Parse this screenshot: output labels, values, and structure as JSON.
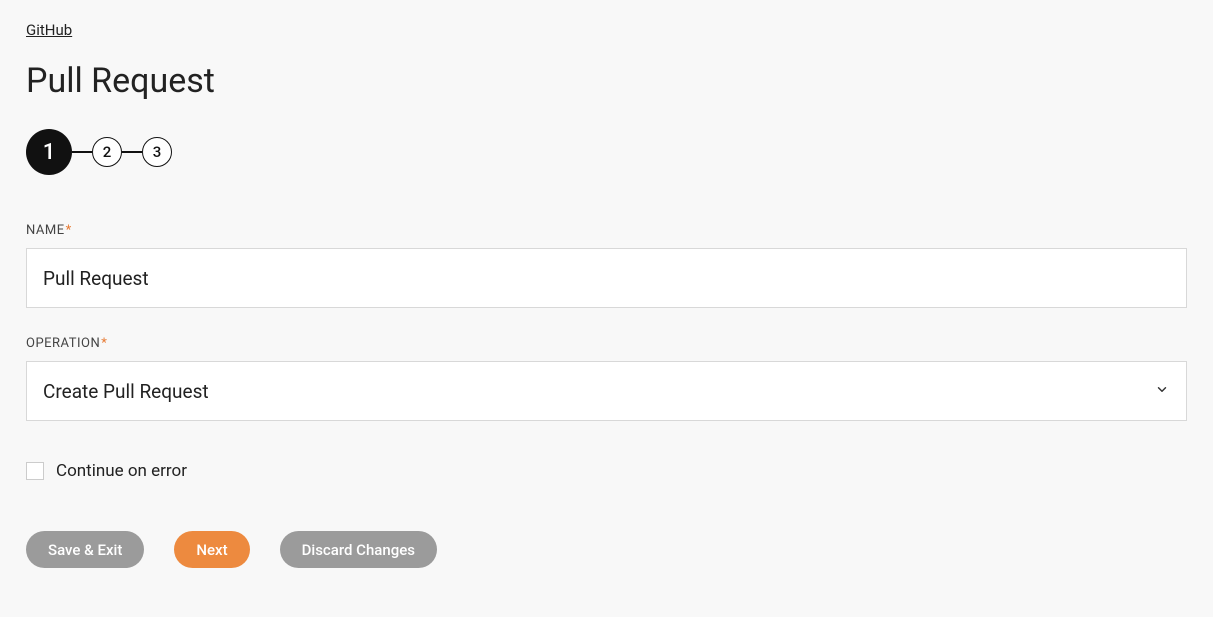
{
  "breadcrumb": "GitHub",
  "title": "Pull Request",
  "stepper": {
    "steps": [
      "1",
      "2",
      "3"
    ],
    "active_index": 0
  },
  "form": {
    "name": {
      "label": "NAME",
      "required": true,
      "value": "Pull Request"
    },
    "operation": {
      "label": "OPERATION",
      "required": true,
      "value": "Create Pull Request"
    },
    "continue_on_error": {
      "label": "Continue on error",
      "checked": false
    }
  },
  "buttons": {
    "save_exit": "Save & Exit",
    "next": "Next",
    "discard": "Discard Changes"
  },
  "required_marker": "*"
}
